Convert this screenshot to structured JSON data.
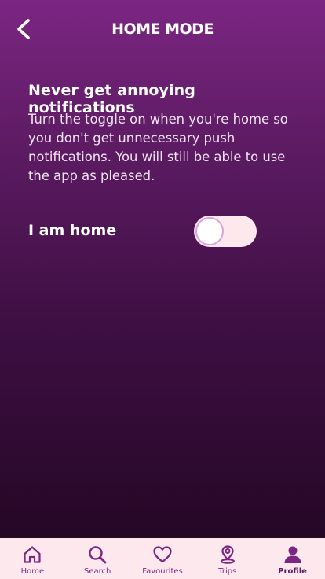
{
  "header": {
    "title": "HOME MODE",
    "back_icon": "chevron-left-icon"
  },
  "content": {
    "heading": "Never get annoying notifications",
    "description": "Turn the toggle on when you're home so you don't get unnecessary push notifications. You will still be able to use the app as pleased.",
    "toggle_label": "I am home",
    "toggle_on": false
  },
  "tabbar": {
    "tabs": [
      {
        "label": "Home",
        "icon": "home-icon"
      },
      {
        "label": "Search",
        "icon": "search-icon"
      },
      {
        "label": "Favourites",
        "icon": "heart-icon"
      },
      {
        "label": "Trips",
        "icon": "map-pin-icon"
      },
      {
        "label": "Profile",
        "icon": "user-icon"
      }
    ],
    "active": "Profile"
  },
  "colors": {
    "gradient_top": "#7b2682",
    "gradient_bottom": "#250726",
    "tabbar_bg": "#fde8ee",
    "accent": "#7b2682"
  }
}
